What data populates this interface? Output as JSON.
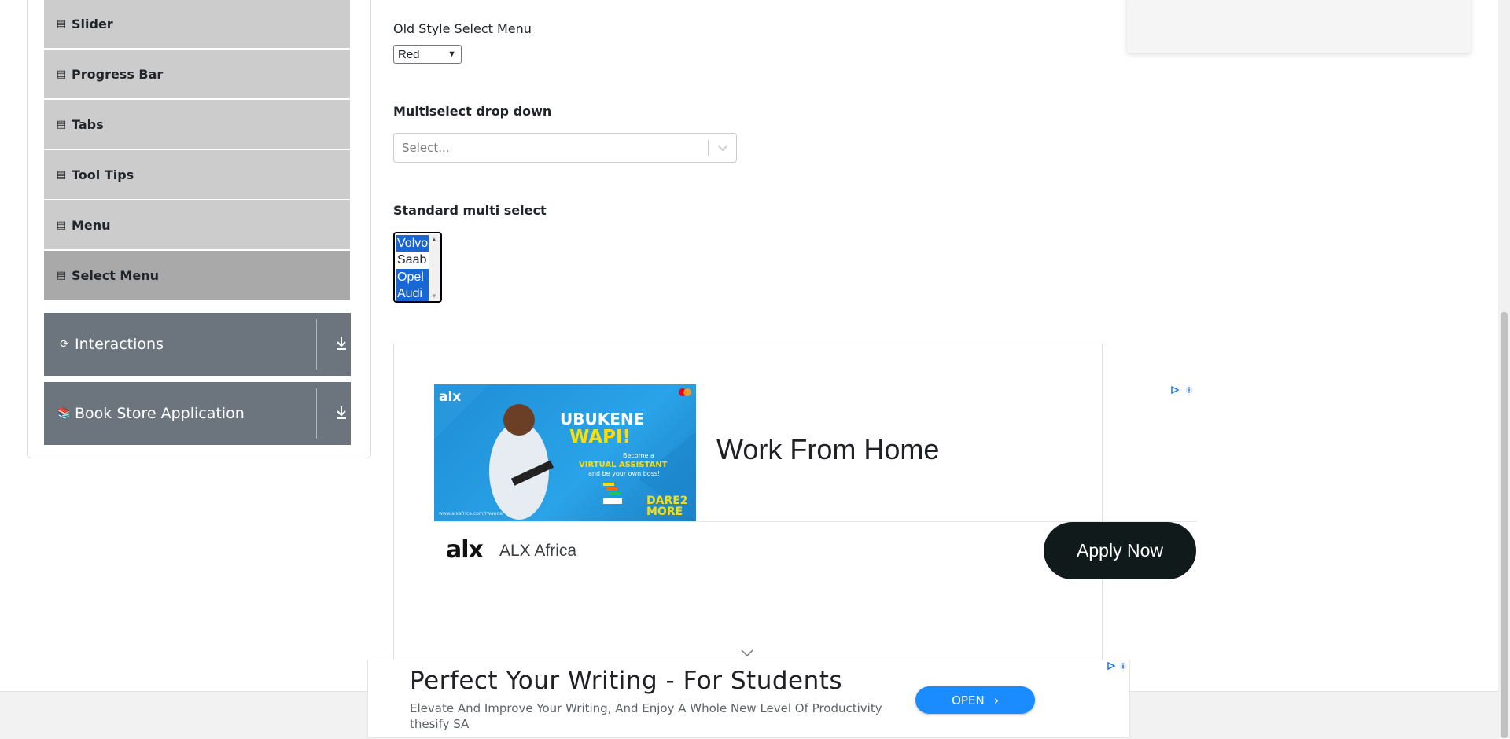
{
  "sidebar": {
    "items": [
      {
        "label": "Slider",
        "icon": "html5-icon"
      },
      {
        "label": "Progress Bar",
        "icon": "html5-icon"
      },
      {
        "label": "Tabs",
        "icon": "html5-icon"
      },
      {
        "label": "Tool Tips",
        "icon": "html5-icon"
      },
      {
        "label": "Menu",
        "icon": "html5-icon"
      },
      {
        "label": "Select Menu",
        "icon": "html5-icon",
        "active": true
      }
    ],
    "groups": [
      {
        "label": "Interactions",
        "icon": "interactions-icon"
      },
      {
        "label": "Book Store Application",
        "icon": "books-icon"
      }
    ]
  },
  "main": {
    "old_select": {
      "label": "Old Style Select Menu",
      "value": "Red"
    },
    "multiselect_dropdown": {
      "label": "Multiselect drop down",
      "placeholder": "Select..."
    },
    "standard_multi": {
      "label": "Standard multi select",
      "options": [
        {
          "label": "Volvo",
          "selected": true
        },
        {
          "label": "Saab",
          "selected": false
        },
        {
          "label": "Opel",
          "selected": true
        },
        {
          "label": "Audi",
          "selected": true
        }
      ]
    }
  },
  "ad": {
    "image_text": {
      "brand": "alx",
      "headline1": "UBUKENE",
      "headline2": "WAPI!",
      "sub1": "Become a",
      "sub2": "VIRTUAL ASSISTANT",
      "sub3": "and be your own boss!",
      "badge1": "DARE2",
      "badge2": "MORE",
      "url": "www.alxafrica.com/rwanda"
    },
    "title": "Work From Home",
    "logo": "alx",
    "advertiser": "ALX Africa",
    "cta": "Apply Now"
  },
  "bottom_ad": {
    "headline": "Perfect Your Writing - For Students",
    "description": "Elevate And Improve Your Writing, And Enjoy A Whole New Level Of Productivity",
    "advertiser": "thesify SA",
    "cta": "OPEN"
  },
  "colors": {
    "sidebar_item": "#cccccc",
    "sidebar_active": "#a9a9a9",
    "group_header": "#6c757d",
    "selected_option": "#1967d2",
    "apply_button": "#111a1b",
    "open_button": "#1a8cff"
  }
}
